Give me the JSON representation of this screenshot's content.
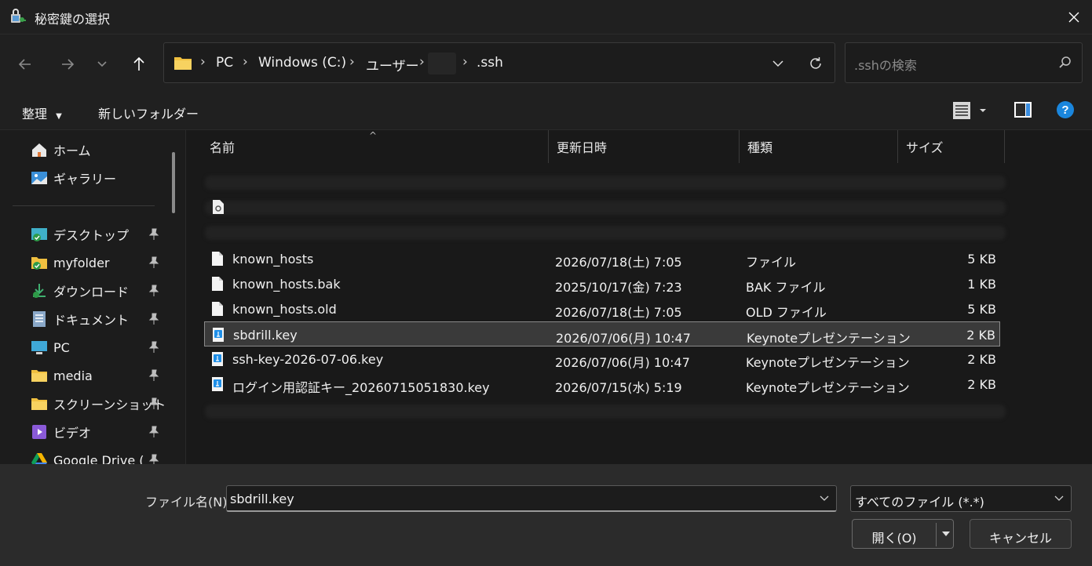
{
  "window": {
    "title": "秘密鍵の選択"
  },
  "address": {
    "crumbs": [
      "PC",
      "Windows (C:)",
      "ユーザー",
      "",
      ".ssh"
    ]
  },
  "search": {
    "placeholder": ".sshの検索"
  },
  "toolbar": {
    "organize_label": "整理",
    "new_folder_label": "新しいフォルダー"
  },
  "sidebar": {
    "items": [
      {
        "label": "ホーム",
        "icon": "home-icon",
        "pinned": false
      },
      {
        "label": "ギャラリー",
        "icon": "gallery-icon",
        "pinned": false
      },
      {
        "label": "デスクトップ",
        "icon": "desktop-icon",
        "pinned": true
      },
      {
        "label": "myfolder",
        "icon": "folder-icon",
        "pinned": true
      },
      {
        "label": "ダウンロード",
        "icon": "download-icon",
        "pinned": true
      },
      {
        "label": "ドキュメント",
        "icon": "document-icon",
        "pinned": true
      },
      {
        "label": "PC",
        "icon": "pc-icon",
        "pinned": true
      },
      {
        "label": "media",
        "icon": "folder-icon",
        "pinned": true
      },
      {
        "label": "スクリーンショット",
        "icon": "folder-icon",
        "pinned": true
      },
      {
        "label": "ビデオ",
        "icon": "video-icon",
        "pinned": true
      },
      {
        "label": "Google Drive (",
        "icon": "google-drive-icon",
        "pinned": true
      }
    ]
  },
  "columns": {
    "name": "名前",
    "date": "更新日時",
    "type": "種類",
    "size": "サイズ"
  },
  "files": [
    {
      "name": "known_hosts",
      "date": "2026/07/18(土) 7:05",
      "type": "ファイル",
      "size": "5 KB",
      "icon": "file-icon",
      "selected": false
    },
    {
      "name": "known_hosts.bak",
      "date": "2025/10/17(金) 7:23",
      "type": "BAK ファイル",
      "size": "1 KB",
      "icon": "file-icon",
      "selected": false
    },
    {
      "name": "known_hosts.old",
      "date": "2026/07/18(土) 7:05",
      "type": "OLD ファイル",
      "size": "5 KB",
      "icon": "file-icon",
      "selected": false
    },
    {
      "name": "sbdrill.key",
      "date": "2026/07/06(月) 10:47",
      "type": "Keynoteプレゼンテーション",
      "size": "2 KB",
      "icon": "keynote-file-icon",
      "selected": true
    },
    {
      "name": "ssh-key-2026-07-06.key",
      "date": "2026/07/06(月) 10:47",
      "type": "Keynoteプレゼンテーション",
      "size": "2 KB",
      "icon": "keynote-file-icon",
      "selected": false
    },
    {
      "name": "ログイン用認証キー_20260715051830.key",
      "date": "2026/07/15(水) 5:19",
      "type": "Keynoteプレゼンテーション",
      "size": "2 KB",
      "icon": "keynote-file-icon",
      "selected": false
    }
  ],
  "footer": {
    "filename_label": "ファイル名(N):",
    "filename_value": "sbdrill.key",
    "filetype_value": "すべてのファイル (*.*)",
    "open_label": "開く(O)",
    "cancel_label": "キャンセル"
  },
  "colors": {
    "accent": "#0078d4",
    "selection_bg": "#3a3a3a",
    "folder": "#f0c040"
  }
}
